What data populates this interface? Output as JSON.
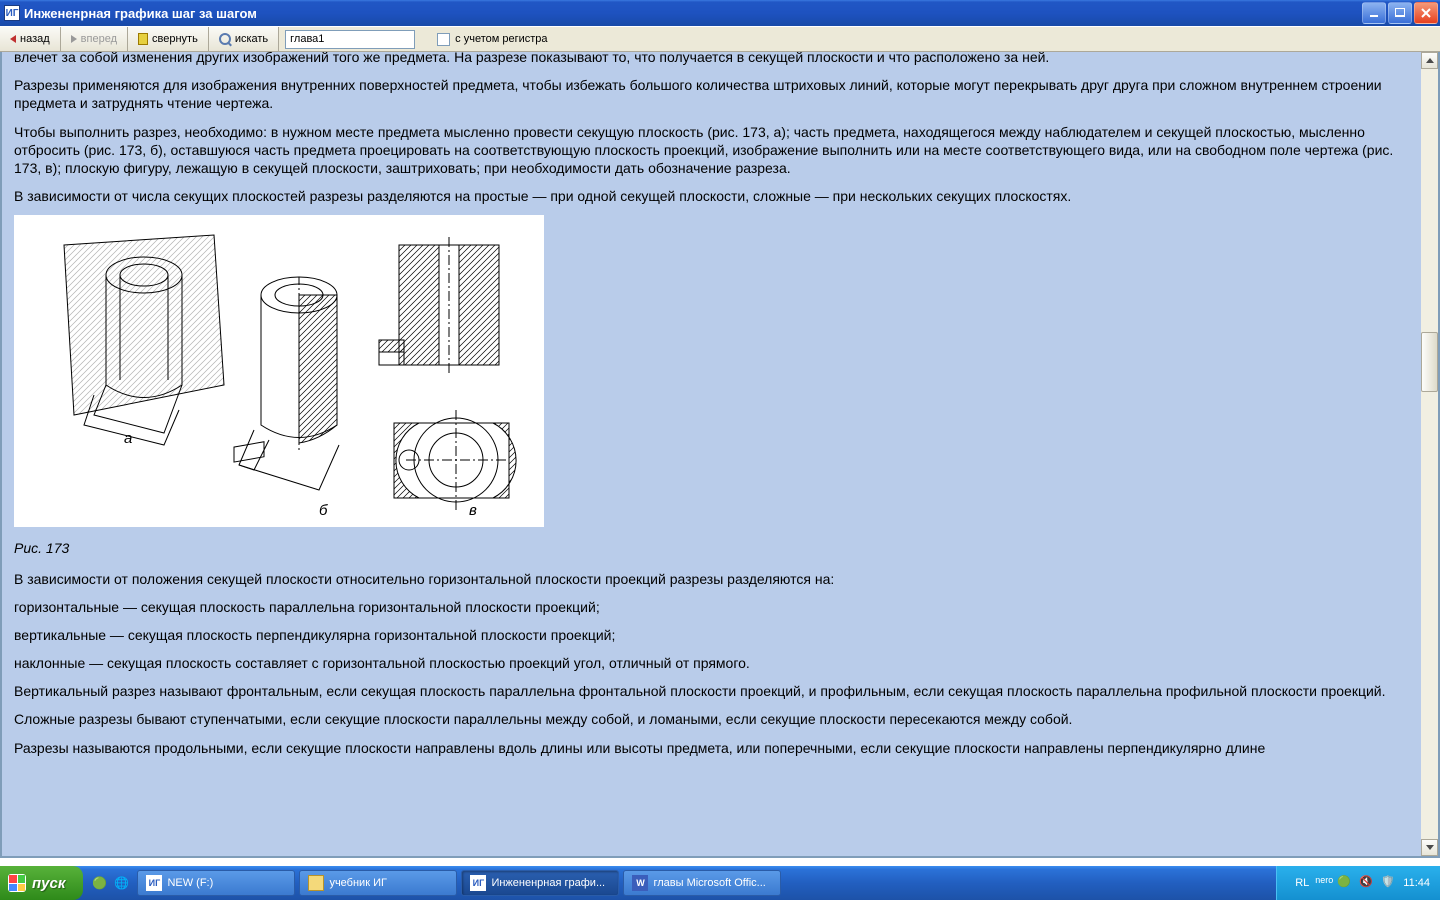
{
  "window": {
    "title": "Инжененрная графика шаг за шагом",
    "app_icon_text": "ИГ"
  },
  "toolbar": {
    "back": "назад",
    "forward": "вперед",
    "collapse": "свернуть",
    "search": "искать",
    "search_value": "глава1",
    "case_label": "с учетом регистра"
  },
  "content": {
    "p1": "влечет за собой изменения других изображений того же предмета. На разрезе показывают то, что получается в секущей плоскости и что расположено за ней.",
    "p2": "Разрезы применяются для изображения внутренних поверхностей предмета, чтобы избежать большого количества штриховых линий, которые могут перекрывать друг друга при сложном внутреннем строении предмета и затруднять чтение чертежа.",
    "p3": "Чтобы выполнить разрез, необходимо: в нужном месте предмета мысленно провести секущую плоскость (рис. 173, а); часть предмета, находящегося между наблюдателем и секущей плоскостью, мысленно отбросить (рис. 173, б), оставшуюся часть предмета проецировать на соответствующую плоскость проекций, изображение выполнить или на месте соответствующего вида, или на свободном поле чертежа (рис. 173, в); плоскую фигуру, лежащую в секущей плоскости, заштриховать; при необходимости дать обозначение разреза.",
    "p4": "В зависимости от числа секущих плоскостей разрезы разделяются на простые — при одной секущей плоскости, сложные — при нескольких секущих плоскостях.",
    "caption": "Рис. 173",
    "p5": "В зависимости от положения секущей плоскости относительно горизонтальной плоскости проекций разрезы разделяются на:",
    "p6": "горизонтальные — секущая плоскость параллельна горизонтальной плоскости проекций;",
    "p7": "вертикальные — секущая плоскость перпендикулярна горизонтальной плоскости проекций;",
    "p8": "наклонные — секущая плоскость составляет с горизонтальной плоскостью проекций угол, отличный от прямого.",
    "p9": "Вертикальный разрез называют фронтальным, если секущая плоскость параллельна фронтальной плоскости проекций, и профильным, если секущая плоскость параллельна профильной плоскости проекций.",
    "p10": "Сложные разрезы бывают ступенчатыми, если секущие плоскости параллельны между собой, и ломаными, если секущие плоскости пересекаются между собой.",
    "p11": "Разрезы называются продольными, если секущие плоскости направлены вдоль длины или высоты предмета, или поперечными, если секущие плоскости направлены перпендикулярно длине"
  },
  "figure_labels": {
    "a": "а",
    "b": "б",
    "v": "в"
  },
  "taskbar": {
    "start": "пуск",
    "tasks": [
      {
        "label": "NEW (F:)",
        "icon": "ИГ",
        "active": false
      },
      {
        "label": "учебник ИГ",
        "icon": "folder",
        "active": false
      },
      {
        "label": "Инжененрная графи...",
        "icon": "ИГ",
        "active": true
      },
      {
        "label": "главы Microsoft Offic...",
        "icon": "W",
        "active": false
      }
    ],
    "lang": "RL",
    "clock": "11:44"
  }
}
